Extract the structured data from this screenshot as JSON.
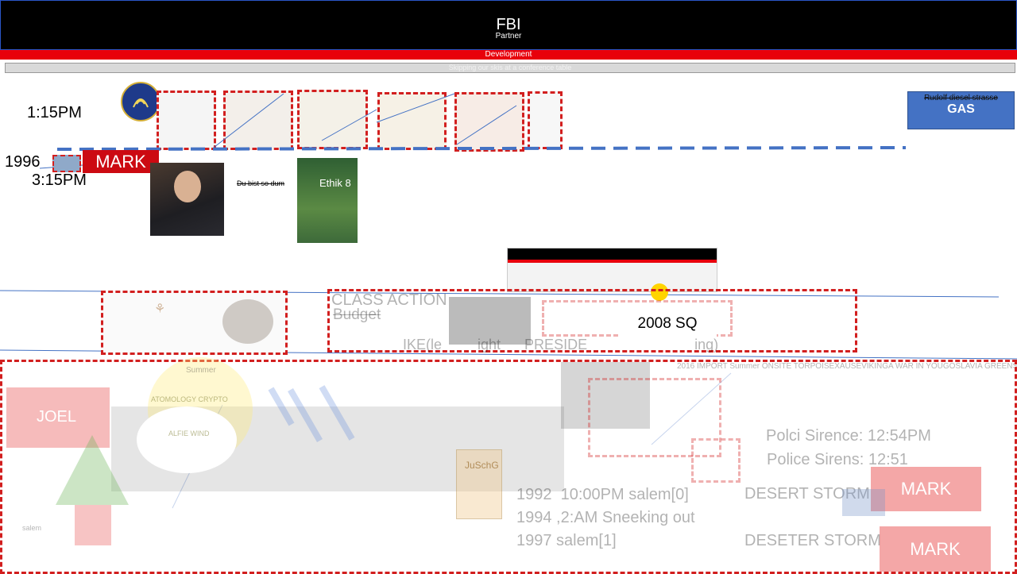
{
  "header": {
    "title": "FBI",
    "subtitle": "Partner"
  },
  "red_bar": {
    "label": "Development"
  },
  "gray_bar": {
    "label": "Skipping our skis at a conference table"
  },
  "times": {
    "t1": "1:15PM",
    "t2": "3:15PM",
    "year": "1996"
  },
  "mark_label": "MARK",
  "gas_box": {
    "top": "Rudolf diesel strasse",
    "label": "GAS"
  },
  "strike_note": "Du bist so dum",
  "book": {
    "title": "Ethik 8"
  },
  "mid_section": {
    "class_action": "CLASS ACTION",
    "budget": "Budget",
    "year_sq": "2008 SQ",
    "ike_line": "IKE(le         ight      PRESIDE                           ing)",
    "import_line": "2016 IMPORT Summer   ONSITE TORPOISEXAUSEVIKINGA WAR IN YOUGOSLAVIA GREENS"
  },
  "lower": {
    "joel": "JOEL",
    "summer": "Summer",
    "circle_top": "ATOMOLOGY CRYPTO",
    "circle_bottom": "ALFIE WIND",
    "salem": "salem",
    "book2": "JuSchG",
    "timeline": [
      "1992  10:00PM salem[0]",
      "1994 ,2:AM Sneeking out",
      "1997 salem[1]"
    ],
    "sirens1": "Polci Sirence: 12:54PM",
    "sirens2": "Police Sirens: 12:51",
    "storm1": "DESERT STORM",
    "storm2": "DESETER STORM",
    "mark1": "MARK",
    "mark2": "MARK"
  },
  "colors": {
    "accent_red": "#d21f1f",
    "blue_dash": "#4472c4",
    "header_bg": "#000000"
  }
}
